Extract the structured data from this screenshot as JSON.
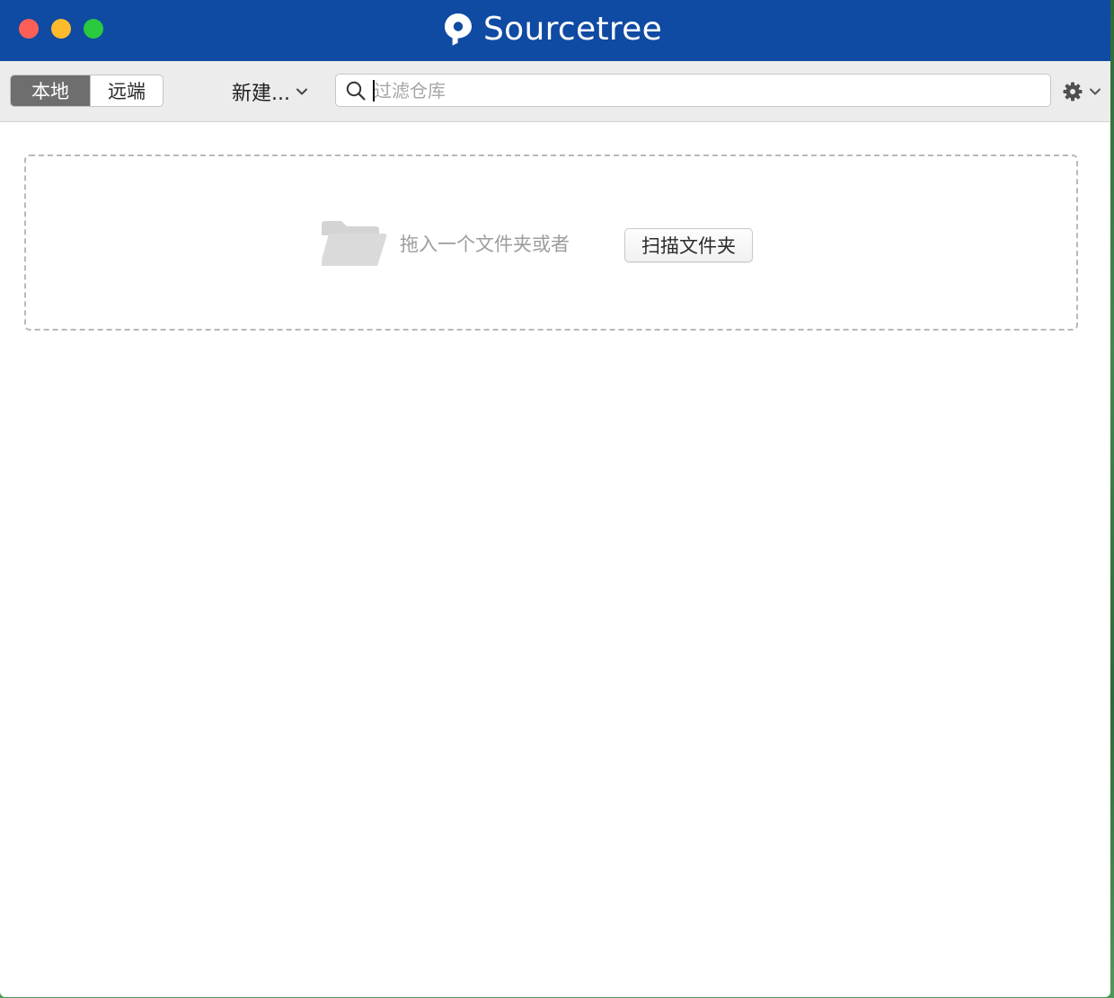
{
  "window": {
    "title": "Sourcetree",
    "traffic_lights": [
      {
        "name": "close",
        "color": "#fd5f57"
      },
      {
        "name": "minimize",
        "color": "#febb2e"
      },
      {
        "name": "maximize",
        "color": "#29c940"
      }
    ],
    "titlebar_color": "#0f4aa3"
  },
  "toolbar": {
    "tabs": [
      {
        "label": "本地",
        "selected": true
      },
      {
        "label": "远端",
        "selected": false
      }
    ],
    "new_label": "新建...",
    "search": {
      "placeholder": "过滤仓库",
      "value": ""
    },
    "settings_icon": "gear-icon"
  },
  "dropzone": {
    "icon": "folder-icon",
    "text": "拖入一个文件夹或者",
    "scan_button_label": "扫描文件夹"
  }
}
